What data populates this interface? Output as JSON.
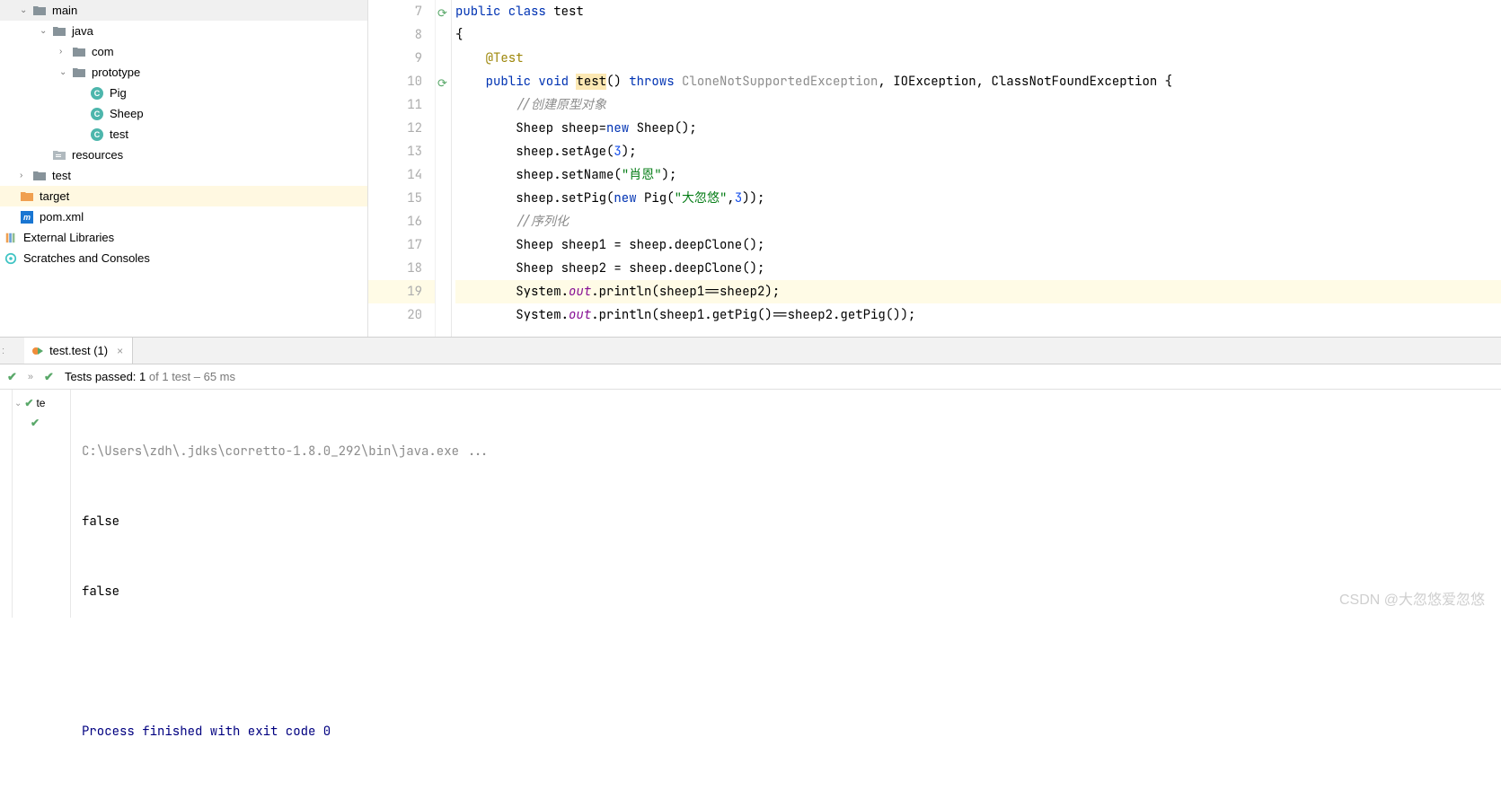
{
  "tree": {
    "main": "main",
    "java": "java",
    "com": "com",
    "prototype": "prototype",
    "pig": "Pig",
    "sheep": "Sheep",
    "test_file": "test",
    "resources": "resources",
    "test_dir": "test",
    "target": "target",
    "pom": "pom.xml",
    "ext_lib": "External Libraries",
    "scratch": "Scratches and Consoles"
  },
  "gutter": {
    "lines": [
      "7",
      "8",
      "9",
      "10",
      "11",
      "12",
      "13",
      "14",
      "15",
      "16",
      "17",
      "18",
      "19",
      "20"
    ]
  },
  "code": {
    "l7_pre": "public class ",
    "l7_cls": "test",
    "l8": "{",
    "l9_ann": "@Test",
    "l10_a": "public void ",
    "l10_name": "test",
    "l10_b": "() ",
    "l10_throws": "throws ",
    "l10_ex1": "CloneNotSupportedException",
    "l10_c": ", IOException, ClassNotFoundException {",
    "l11_cmt": "//创建原型对象",
    "l12": "Sheep sheep=",
    "l12_new": "new",
    "l12_b": " Sheep();",
    "l13_a": "sheep.setAge(",
    "l13_n": "3",
    "l13_b": ");",
    "l14_a": "sheep.setName(",
    "l14_s": "\"肖恩\"",
    "l14_b": ");",
    "l15_a": "sheep.setPig(",
    "l15_new": "new",
    "l15_b": " Pig(",
    "l15_s": "\"大忽悠\"",
    "l15_c": ",",
    "l15_n": "3",
    "l15_d": "));",
    "l16_cmt": "//序列化",
    "l17": "Sheep sheep1 = sheep.deepClone();",
    "l18": "Sheep sheep2 = sheep.deepClone();",
    "l19_a": "System.",
    "l19_out": "out",
    "l19_b": ".println(sheep1==sheep2);",
    "l20_a": "System.",
    "l20_out": "out",
    "l20_b": ".println(sheep1.getPig()==sheep2.getPig());"
  },
  "tab": {
    "label": "test.test (1)"
  },
  "status": {
    "passed_pre": "Tests passed: ",
    "passed_n": "1",
    "passed_post": " of 1 test – 65 ms"
  },
  "test_tree": {
    "root": "te"
  },
  "console": {
    "cmd": "C:\\Users\\zdh\\.jdks\\corretto-1.8.0_292\\bin\\java.exe ...",
    "out1": "false",
    "out2": "false",
    "exit": "Process finished with exit code 0"
  },
  "watermark": "CSDN @大忽悠爱忽悠"
}
